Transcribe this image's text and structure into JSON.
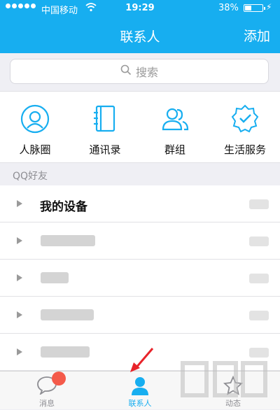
{
  "status_bar": {
    "carrier": "中国移动",
    "time": "19:29",
    "battery": "38%",
    "battery_level": 0.38
  },
  "nav": {
    "title": "联系人",
    "action": "添加"
  },
  "search": {
    "placeholder": "搜索"
  },
  "quick_actions": [
    {
      "label": "人脉圈",
      "icon": "person-circle-icon"
    },
    {
      "label": "通讯录",
      "icon": "address-book-icon"
    },
    {
      "label": "群组",
      "icon": "group-icon"
    },
    {
      "label": "生活服务",
      "icon": "service-badge-icon"
    }
  ],
  "section": {
    "title": "QQ好友"
  },
  "groups": [
    {
      "name": "我的设备"
    }
  ],
  "tabs": [
    {
      "label": "消息",
      "icon": "message-bubble-icon"
    },
    {
      "label": "联系人",
      "icon": "contacts-person-icon"
    },
    {
      "label": "动态",
      "icon": "star-icon"
    }
  ],
  "colors": {
    "accent": "#17aef0",
    "badge": "#f45a4a",
    "background": "#efeff4"
  }
}
